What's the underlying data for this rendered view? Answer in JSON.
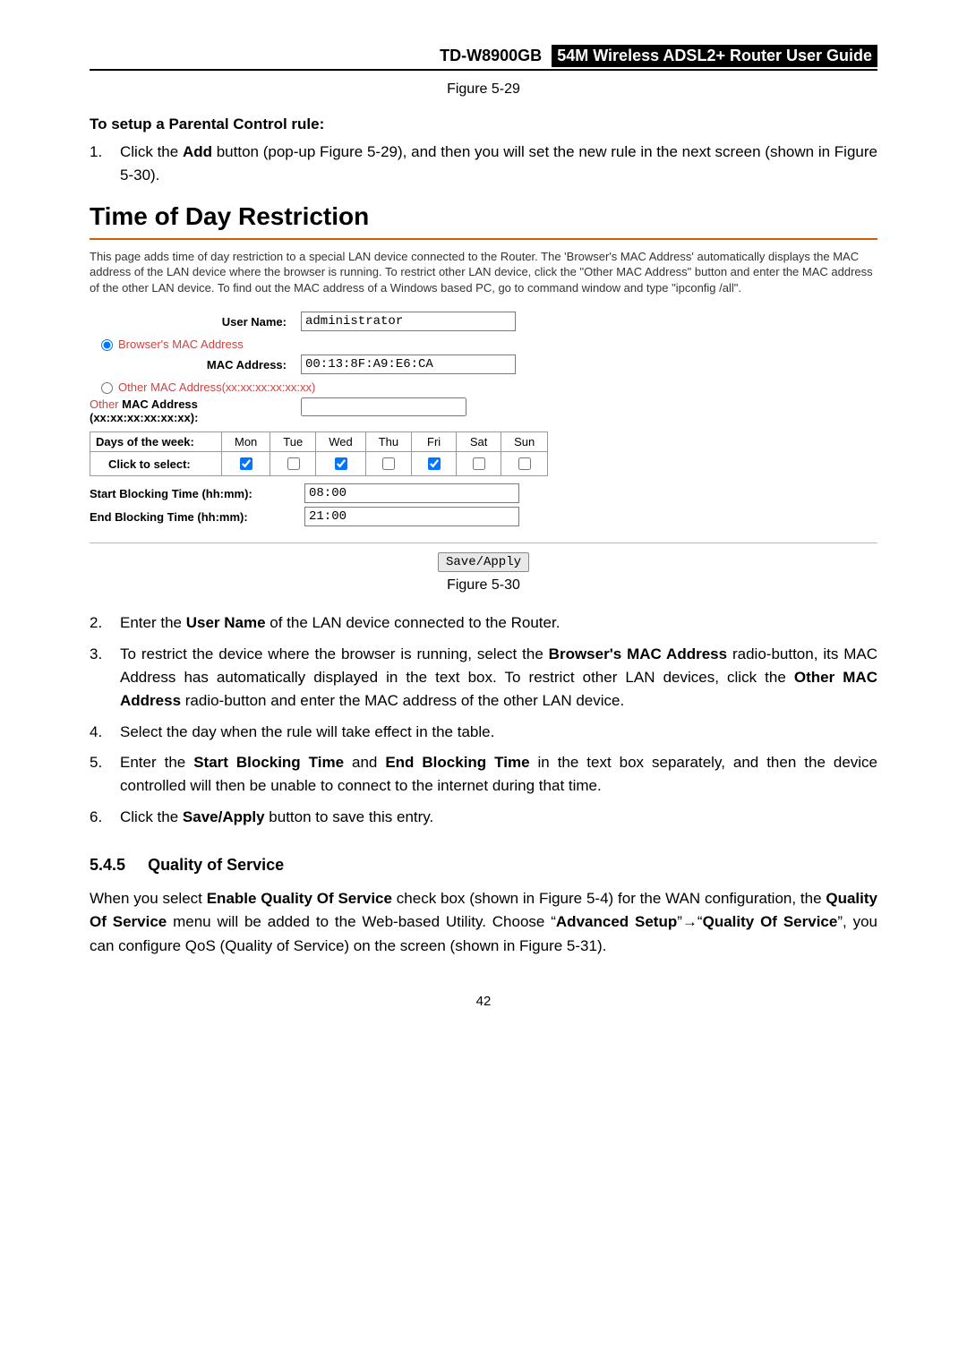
{
  "header": {
    "model": "TD-W8900GB",
    "title_rest": "54M Wireless ADSL2+ Router User Guide"
  },
  "fig29": "Figure 5-29",
  "setup_title": "To setup a Parental Control rule:",
  "step1": {
    "num": "1.",
    "text_before": "Click the ",
    "bold1": "Add",
    "text_after": " button (pop-up Figure 5-29), and then you will set the new rule in the next screen (shown in Figure 5-30)."
  },
  "screenshot": {
    "title": "Time of Day Restriction",
    "desc": "This page adds time of day restriction to a special LAN device connected to the Router. The 'Browser's MAC Address' automatically displays the MAC address of the LAN device where the browser is running. To restrict other LAN device, click the \"Other MAC Address\" button and enter the MAC address of the other LAN device. To find out the MAC address of a Windows based PC, go to command window and type \"ipconfig /all\".",
    "user_name_label": "User Name:",
    "user_name_value": "administrator",
    "radio_browser": "Browser's MAC Address",
    "mac_label": "MAC Address:",
    "mac_value": "00:13:8F:A9:E6:CA",
    "radio_other": "Other MAC Address(xx:xx:xx:xx:xx:xx)",
    "other_mac_line1": "Other",
    "other_mac_bold": "MAC Address",
    "other_mac_line2": "(xx:xx:xx:xx:xx:xx):",
    "other_mac_value": "",
    "days_header": "Days of the week:",
    "click_select": "Click to select:",
    "days": [
      "Mon",
      "Tue",
      "Wed",
      "Thu",
      "Fri",
      "Sat",
      "Sun"
    ],
    "days_checked": [
      true,
      false,
      true,
      false,
      true,
      false,
      false
    ],
    "start_label": "Start Blocking Time (hh:mm):",
    "start_value": "08:00",
    "end_label": "End Blocking Time (hh:mm):",
    "end_value": "21:00",
    "save_button": "Save/Apply"
  },
  "fig30": "Figure 5-30",
  "step2": {
    "num": "2.",
    "pre": "Enter the ",
    "b1": "User Name",
    "post": " of the LAN device connected to the Router."
  },
  "step3": {
    "num": "3.",
    "pre": "To restrict the device where the browser is running, select the ",
    "b1": "Browser's MAC Address",
    "mid1": " radio-button, its MAC Address has automatically displayed in the text box. To restrict other LAN devices, click the ",
    "b2": "Other MAC Address",
    "post": " radio-button and enter the MAC address of the other LAN device."
  },
  "step4": {
    "num": "4.",
    "text": "Select the day when the rule will take effect in the table."
  },
  "step5": {
    "num": "5.",
    "pre": "Enter the ",
    "b1": "Start Blocking Time",
    "mid": " and ",
    "b2": "End Blocking Time",
    "post": " in the text box separately, and then the device controlled will then be unable to connect to the internet during that time."
  },
  "step6": {
    "num": "6.",
    "pre": "Click the ",
    "b1": "Save/Apply",
    "post": " button to save this entry."
  },
  "section": {
    "num": "5.4.5",
    "title": "Quality of Service"
  },
  "qos_para": {
    "t1": "When you select ",
    "b1": "Enable Quality Of Service",
    "t2": " check box (shown in Figure 5-4) for the WAN configuration, the ",
    "b2": "Quality Of Service",
    "t3": " menu will be added to the Web-based Utility. Choose “",
    "b3": "Advanced Setup",
    "t4": "”",
    "arrow": "→",
    "t5": "“",
    "b4": "Quality Of Service",
    "t6": "”, you can configure QoS (Quality of Service) on the screen (shown in Figure 5-31)."
  },
  "page_num": "42"
}
